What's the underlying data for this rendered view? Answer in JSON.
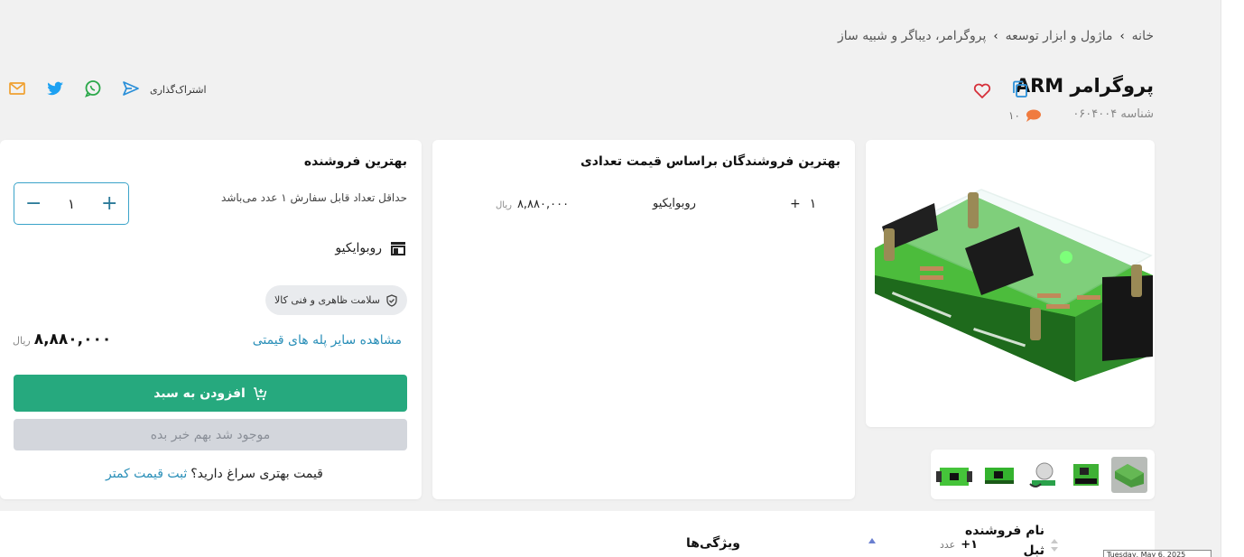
{
  "breadcrumb": {
    "items": [
      "خانه",
      "ماژول و ابزار توسعه",
      "پروگرامر، دیباگر و شبیه ساز"
    ]
  },
  "product": {
    "title": "پروگرامر ARM",
    "sku": "شناسه ۰۶۰۴۰۰۴",
    "comments_count": "۱۰"
  },
  "share": {
    "label": "اشتراک‌گذاری",
    "icons": [
      "send-icon",
      "whatsapp-icon",
      "twitter-icon",
      "mail-icon"
    ]
  },
  "tiers": {
    "title": "بهترین فروشندگان براساس قیمت تعدادی",
    "rows": [
      {
        "qty": "۱",
        "plus": "+",
        "seller": "روبوایکیو",
        "price": "۸,۸۸۰,۰۰۰",
        "currency": "ریال"
      }
    ]
  },
  "seller": {
    "title": "بهترین فروشنده",
    "min_order": "حداقل تعداد قابل سفارش ۱ عدد می‌باشد",
    "qty_value": "۱",
    "qty_minus": "−",
    "qty_plus": "+",
    "shop_name": "روبوایکیو",
    "badge": "سلامت ظاهری و فنی کالا",
    "price": "۸,۸۸۰,۰۰۰",
    "currency": "ریال",
    "tiers_link": "مشاهده سایر پله های قیمتی",
    "add_to_cart": "افزودن به سبد",
    "notify": "موجود شد بهم خبر بده",
    "better_price_q": "قیمت بهتری سراغ دارید؟",
    "better_price_link": "ثبت قیمت کمتر"
  },
  "bottom": {
    "seller_name_header": "نام فروشنده",
    "seller_name_header_2": "ثبل",
    "qty_plus": "+۱",
    "qty_unit": "عدد",
    "features_header": "ویژگی‌ها",
    "tooltip": "Tuesday, May 6, 2025"
  },
  "colors": {
    "accent_green": "#26a97e",
    "link_blue": "#2a8fb8",
    "heart_red": "#d6303a",
    "chat_orange": "#f07b3f"
  }
}
